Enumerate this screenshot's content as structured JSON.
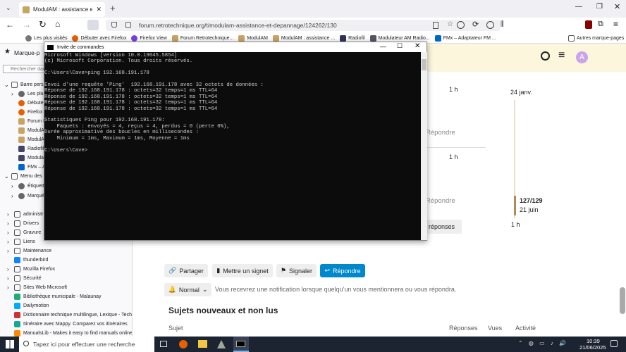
{
  "browser": {
    "tab_title": "ModulAM : assistance et dépan",
    "url": "forum.retrotechnique.org/t/modulam-assistance-et-depannage/124262/130"
  },
  "bookmarks": [
    "Les plus visités",
    "Débuter avec Firefox",
    "Firefox View",
    "Forum Retrotechnique...",
    "ModulAM",
    "ModulAM : assistance ...",
    "Radiofil",
    "Modulateur AM Radio...",
    "FMx – Adaptateur FM ..."
  ],
  "bookmarks_other": "Autres marque-pages",
  "sidebar": {
    "title": "Marque-p",
    "search_placeholder": "Rechercher dan",
    "items": [
      {
        "label": "Barre perso",
        "icon": "folder-icon"
      },
      {
        "label": "Les plus",
        "icon": "gear-icon"
      },
      {
        "label": "Débuter",
        "icon": "firefox-icon"
      },
      {
        "label": "Firefox V",
        "icon": "firefox-icon"
      },
      {
        "label": "Forum Re",
        "icon": "retro-icon"
      },
      {
        "label": "ModulAM",
        "icon": "retro-icon"
      },
      {
        "label": "ModulAM",
        "icon": "retro-icon"
      },
      {
        "label": "Radiofil",
        "icon": "radio-icon"
      },
      {
        "label": "Modulato",
        "icon": "radio-icon"
      },
      {
        "label": "FMx – Ad",
        "icon": "fmx-icon"
      },
      {
        "label": "Menu des m",
        "icon": "folder-icon"
      },
      {
        "label": "Étiquettes",
        "icon": "gear-icon"
      },
      {
        "label": "Marqués",
        "icon": "gear-icon"
      },
      {
        "label": "administr",
        "icon": "folder-icon"
      },
      {
        "label": "Drivers",
        "icon": "folder-icon"
      },
      {
        "label": "Gravure",
        "icon": "folder-icon"
      },
      {
        "label": "Liens",
        "icon": "folder-icon"
      },
      {
        "label": "Maintenance",
        "icon": "folder-icon"
      },
      {
        "label": "thunderbird",
        "icon": "thunderbird-icon"
      },
      {
        "label": "Mozilla Firefox",
        "icon": "folder-icon"
      },
      {
        "label": "Sécurité",
        "icon": "folder-icon"
      },
      {
        "label": "Sites Web Microsoft",
        "icon": "folder-icon"
      },
      {
        "label": "Bibliothèque municipale - Malaunay",
        "icon": "library-icon"
      },
      {
        "label": "Dailymotion",
        "icon": "dailymotion-icon"
      },
      {
        "label": "Dictionnaire technique multilingue, Lexique - Tech...",
        "icon": "dict-icon"
      },
      {
        "label": "Itinéraire avec Mappy. Comparez vos itinéraires",
        "icon": "mappy-icon"
      },
      {
        "label": "ManualsLib - Makes it easy to find manuals online!",
        "icon": "manualslib-icon"
      }
    ]
  },
  "terminal": {
    "title": "Invite de commandes",
    "lines": [
      "Microsoft Windows [version 10.0.19045.5854]",
      "(c) Microsoft Corporation. Tous droits réservés.",
      "",
      "C:\\Users\\Cave>ping 192.168.191.178",
      "",
      "Envoi d’une requête 'Ping'  192.168.191.178 avec 32 octets de données :",
      "Réponse de 192.168.191.178 : octets=32 temps=1 ms TTL=64",
      "Réponse de 192.168.191.178 : octets=32 temps=1 ms TTL=64",
      "Réponse de 192.168.191.178 : octets=32 temps=1 ms TTL=64",
      "Réponse de 192.168.191.178 : octets=32 temps=1 ms TTL=64",
      "",
      "Statistiques Ping pour 192.168.191.178:",
      "    Paquets : envoyés = 4, reçus = 4, perdus = 0 (perte 0%),",
      "Durée approximative des boucles en millisecondes :",
      "    Minimum = 1ms, Maximum = 1ms, Moyenne = 1ms",
      "",
      "C:\\Users\\Cave>"
    ]
  },
  "forum": {
    "avatar_letter": "A",
    "time1": "1 h",
    "time2": "1 h",
    "time3": "1 h",
    "date_top": "24 janv.",
    "reply_link": "Répondre",
    "progress": "127/129",
    "progress_fraction": 0.984,
    "date_bottom": "21 juin",
    "replies_partial": "s réponses",
    "share": "Partager",
    "bookmark": "Mettre un signet",
    "flag": "Signaler",
    "reply": "Répondre",
    "notify": "Normal",
    "notify_text": "Vous recevrez une notification lorsque quelqu'un vous mentionnera ou vous répondra.",
    "section_title": "Sujets nouveaux et non lus",
    "col_topic": "Sujet",
    "col_replies": "Réponses",
    "col_views": "Vues",
    "col_activity": "Activité",
    "accent": "#0088cc"
  },
  "taskbar": {
    "search_placeholder": "Tapez ici pour effectuer une recherche",
    "time": "10:39",
    "date": "21/06/2025"
  }
}
